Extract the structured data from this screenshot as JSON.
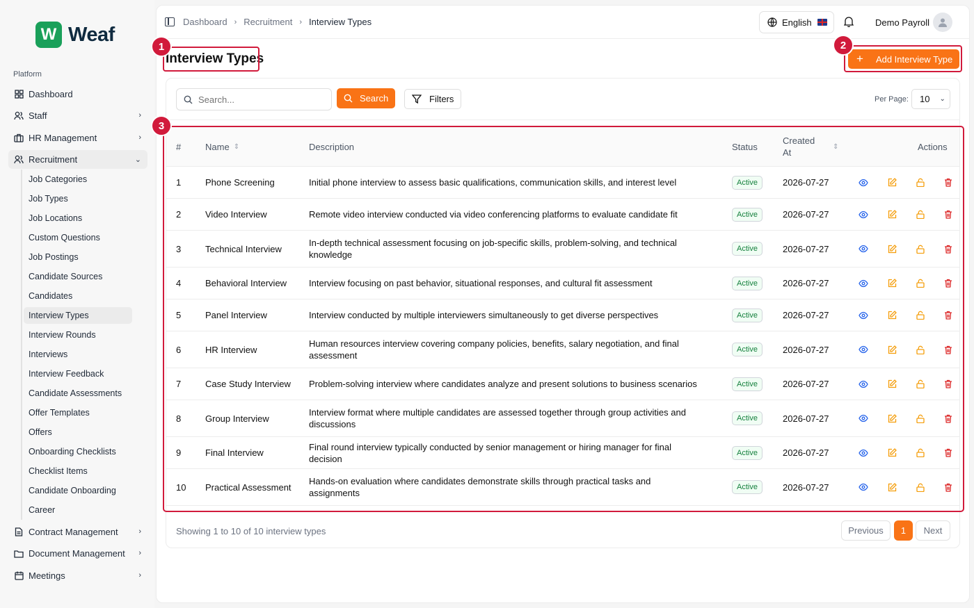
{
  "brand": {
    "logo_letter": "W",
    "name": "Weaf"
  },
  "sidebar": {
    "section_label": "Platform",
    "items": [
      {
        "label": "Dashboard",
        "icon": "grid-icon"
      },
      {
        "label": "Staff",
        "icon": "users-icon"
      },
      {
        "label": "HR Management",
        "icon": "briefcase-icon"
      },
      {
        "label": "Recruitment",
        "icon": "user-plus-icon"
      },
      {
        "label": "Contract Management",
        "icon": "file-text-icon"
      },
      {
        "label": "Document Management",
        "icon": "folder-icon"
      },
      {
        "label": "Meetings",
        "icon": "calendar-icon"
      }
    ],
    "recruitment_sub": [
      "Job Categories",
      "Job Types",
      "Job Locations",
      "Custom Questions",
      "Job Postings",
      "Candidate Sources",
      "Candidates",
      "Interview Types",
      "Interview Rounds",
      "Interviews",
      "Interview Feedback",
      "Candidate Assessments",
      "Offer Templates",
      "Offers",
      "Onboarding Checklists",
      "Checklist Items",
      "Candidate Onboarding",
      "Career"
    ],
    "active_sub": "Interview Types"
  },
  "breadcrumb": [
    "Dashboard",
    "Recruitment",
    "Interview Types"
  ],
  "header": {
    "language": "English",
    "user": "Demo Payroll"
  },
  "page": {
    "title": "Interview Types",
    "add_button": "Add Interview Type"
  },
  "annotations": [
    "1",
    "2",
    "3"
  ],
  "filters": {
    "search_placeholder": "Search...",
    "search_button": "Search",
    "filters_button": "Filters",
    "per_page_label": "Per Page:",
    "per_page_value": "10"
  },
  "table": {
    "columns": {
      "num": "#",
      "name": "Name",
      "description": "Description",
      "status": "Status",
      "created": "Created At",
      "actions": "Actions"
    },
    "rows": [
      {
        "num": "1",
        "name": "Phone Screening",
        "description": "Initial phone interview to assess basic qualifications, communication skills, and interest level",
        "status": "Active",
        "created": "2026-07-27"
      },
      {
        "num": "2",
        "name": "Video Interview",
        "description": "Remote video interview conducted via video conferencing platforms to evaluate candidate fit",
        "status": "Active",
        "created": "2026-07-27"
      },
      {
        "num": "3",
        "name": "Technical Interview",
        "description": "In-depth technical assessment focusing on job-specific skills, problem-solving, and technical knowledge",
        "status": "Active",
        "created": "2026-07-27"
      },
      {
        "num": "4",
        "name": "Behavioral Interview",
        "description": "Interview focusing on past behavior, situational responses, and cultural fit assessment",
        "status": "Active",
        "created": "2026-07-27"
      },
      {
        "num": "5",
        "name": "Panel Interview",
        "description": "Interview conducted by multiple interviewers simultaneously to get diverse perspectives",
        "status": "Active",
        "created": "2026-07-27"
      },
      {
        "num": "6",
        "name": "HR Interview",
        "description": "Human resources interview covering company policies, benefits, salary negotiation, and final assessment",
        "status": "Active",
        "created": "2026-07-27"
      },
      {
        "num": "7",
        "name": "Case Study Interview",
        "description": "Problem-solving interview where candidates analyze and present solutions to business scenarios",
        "status": "Active",
        "created": "2026-07-27"
      },
      {
        "num": "8",
        "name": "Group Interview",
        "description": "Interview format where multiple candidates are assessed together through group activities and discussions",
        "status": "Active",
        "created": "2026-07-27"
      },
      {
        "num": "9",
        "name": "Final Interview",
        "description": "Final round interview typically conducted by senior management or hiring manager for final decision",
        "status": "Active",
        "created": "2026-07-27"
      },
      {
        "num": "10",
        "name": "Practical Assessment",
        "description": "Hands-on evaluation where candidates demonstrate skills through practical tasks and assignments",
        "status": "Active",
        "created": "2026-07-27"
      }
    ]
  },
  "footer": {
    "summary": "Showing 1 to 10 of 10 interview types",
    "prev": "Previous",
    "page": "1",
    "next": "Next"
  },
  "colors": {
    "accent": "#f97316",
    "highlight": "#d11a3b",
    "brand_green": "#1aa05a",
    "action_blue": "#2563eb",
    "action_orange": "#f59e0b",
    "action_red": "#dc2626"
  }
}
